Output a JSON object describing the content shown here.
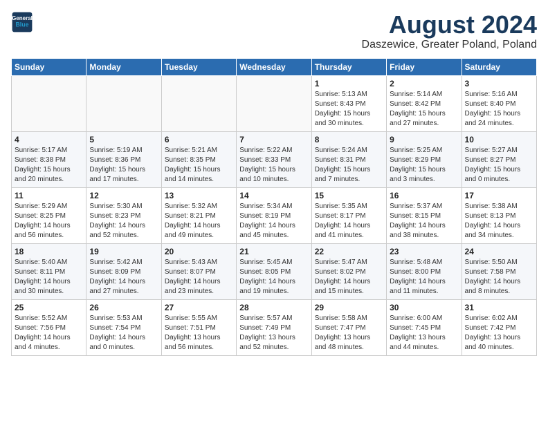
{
  "logo": {
    "line1": "General",
    "line2": "Blue"
  },
  "title": "August 2024",
  "subtitle": "Daszewice, Greater Poland, Poland",
  "weekdays": [
    "Sunday",
    "Monday",
    "Tuesday",
    "Wednesday",
    "Thursday",
    "Friday",
    "Saturday"
  ],
  "weeks": [
    [
      {
        "day": "",
        "info": ""
      },
      {
        "day": "",
        "info": ""
      },
      {
        "day": "",
        "info": ""
      },
      {
        "day": "",
        "info": ""
      },
      {
        "day": "1",
        "info": "Sunrise: 5:13 AM\nSunset: 8:43 PM\nDaylight: 15 hours\nand 30 minutes."
      },
      {
        "day": "2",
        "info": "Sunrise: 5:14 AM\nSunset: 8:42 PM\nDaylight: 15 hours\nand 27 minutes."
      },
      {
        "day": "3",
        "info": "Sunrise: 5:16 AM\nSunset: 8:40 PM\nDaylight: 15 hours\nand 24 minutes."
      }
    ],
    [
      {
        "day": "4",
        "info": "Sunrise: 5:17 AM\nSunset: 8:38 PM\nDaylight: 15 hours\nand 20 minutes."
      },
      {
        "day": "5",
        "info": "Sunrise: 5:19 AM\nSunset: 8:36 PM\nDaylight: 15 hours\nand 17 minutes."
      },
      {
        "day": "6",
        "info": "Sunrise: 5:21 AM\nSunset: 8:35 PM\nDaylight: 15 hours\nand 14 minutes."
      },
      {
        "day": "7",
        "info": "Sunrise: 5:22 AM\nSunset: 8:33 PM\nDaylight: 15 hours\nand 10 minutes."
      },
      {
        "day": "8",
        "info": "Sunrise: 5:24 AM\nSunset: 8:31 PM\nDaylight: 15 hours\nand 7 minutes."
      },
      {
        "day": "9",
        "info": "Sunrise: 5:25 AM\nSunset: 8:29 PM\nDaylight: 15 hours\nand 3 minutes."
      },
      {
        "day": "10",
        "info": "Sunrise: 5:27 AM\nSunset: 8:27 PM\nDaylight: 15 hours\nand 0 minutes."
      }
    ],
    [
      {
        "day": "11",
        "info": "Sunrise: 5:29 AM\nSunset: 8:25 PM\nDaylight: 14 hours\nand 56 minutes."
      },
      {
        "day": "12",
        "info": "Sunrise: 5:30 AM\nSunset: 8:23 PM\nDaylight: 14 hours\nand 52 minutes."
      },
      {
        "day": "13",
        "info": "Sunrise: 5:32 AM\nSunset: 8:21 PM\nDaylight: 14 hours\nand 49 minutes."
      },
      {
        "day": "14",
        "info": "Sunrise: 5:34 AM\nSunset: 8:19 PM\nDaylight: 14 hours\nand 45 minutes."
      },
      {
        "day": "15",
        "info": "Sunrise: 5:35 AM\nSunset: 8:17 PM\nDaylight: 14 hours\nand 41 minutes."
      },
      {
        "day": "16",
        "info": "Sunrise: 5:37 AM\nSunset: 8:15 PM\nDaylight: 14 hours\nand 38 minutes."
      },
      {
        "day": "17",
        "info": "Sunrise: 5:38 AM\nSunset: 8:13 PM\nDaylight: 14 hours\nand 34 minutes."
      }
    ],
    [
      {
        "day": "18",
        "info": "Sunrise: 5:40 AM\nSunset: 8:11 PM\nDaylight: 14 hours\nand 30 minutes."
      },
      {
        "day": "19",
        "info": "Sunrise: 5:42 AM\nSunset: 8:09 PM\nDaylight: 14 hours\nand 27 minutes."
      },
      {
        "day": "20",
        "info": "Sunrise: 5:43 AM\nSunset: 8:07 PM\nDaylight: 14 hours\nand 23 minutes."
      },
      {
        "day": "21",
        "info": "Sunrise: 5:45 AM\nSunset: 8:05 PM\nDaylight: 14 hours\nand 19 minutes."
      },
      {
        "day": "22",
        "info": "Sunrise: 5:47 AM\nSunset: 8:02 PM\nDaylight: 14 hours\nand 15 minutes."
      },
      {
        "day": "23",
        "info": "Sunrise: 5:48 AM\nSunset: 8:00 PM\nDaylight: 14 hours\nand 11 minutes."
      },
      {
        "day": "24",
        "info": "Sunrise: 5:50 AM\nSunset: 7:58 PM\nDaylight: 14 hours\nand 8 minutes."
      }
    ],
    [
      {
        "day": "25",
        "info": "Sunrise: 5:52 AM\nSunset: 7:56 PM\nDaylight: 14 hours\nand 4 minutes."
      },
      {
        "day": "26",
        "info": "Sunrise: 5:53 AM\nSunset: 7:54 PM\nDaylight: 14 hours\nand 0 minutes."
      },
      {
        "day": "27",
        "info": "Sunrise: 5:55 AM\nSunset: 7:51 PM\nDaylight: 13 hours\nand 56 minutes."
      },
      {
        "day": "28",
        "info": "Sunrise: 5:57 AM\nSunset: 7:49 PM\nDaylight: 13 hours\nand 52 minutes."
      },
      {
        "day": "29",
        "info": "Sunrise: 5:58 AM\nSunset: 7:47 PM\nDaylight: 13 hours\nand 48 minutes."
      },
      {
        "day": "30",
        "info": "Sunrise: 6:00 AM\nSunset: 7:45 PM\nDaylight: 13 hours\nand 44 minutes."
      },
      {
        "day": "31",
        "info": "Sunrise: 6:02 AM\nSunset: 7:42 PM\nDaylight: 13 hours\nand 40 minutes."
      }
    ]
  ]
}
